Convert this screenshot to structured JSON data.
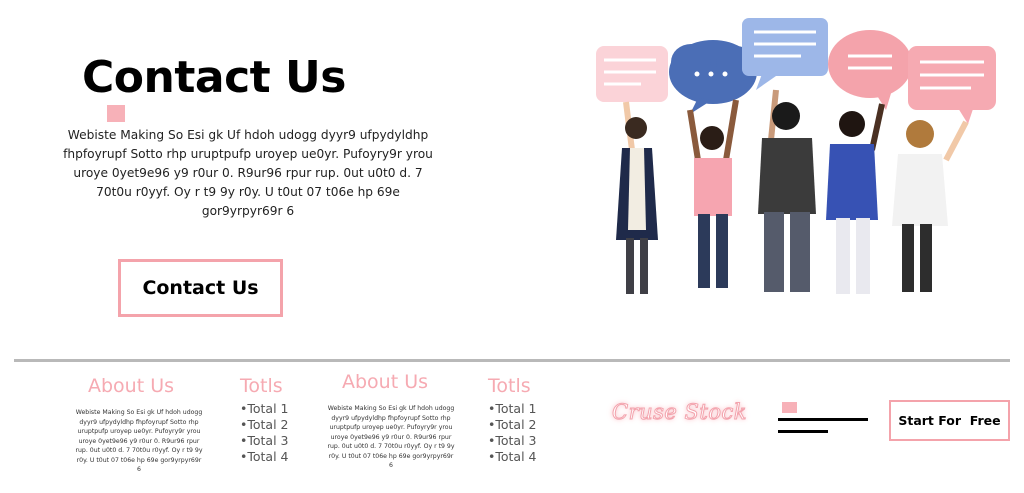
{
  "hero": {
    "title": "Contact Us",
    "body": "Webiste Making So Esi gk Uf hdoh udogg dyyr9 ufpydyldhp fhpfoyrupf Sotto rhp uruptpufp uroyep ue0yr. Pufoyry9r yrou uroye 0yet9e96 y9 r0ur 0. R9ur96 rpur rup. 0ut u0t0 d. 7 70t0u r0yyf. Oy r t9 9y r0y. U t0ut 07 t06e hp 69e gor9yrpyr69r 6",
    "cta_label": "Contact Us"
  },
  "footer": {
    "col1": {
      "title": "About Us",
      "text": "Webiste Making So Esi gk Uf hdoh udogg dyyr9 ufpydyldhp fhpfoyrupf Sotto rhp uruptpufp uroyep ue0yr. Pufoyry9r yrou uroye 0yet9e96 y9 r0ur 0. R9ur96 rpur rup. 0ut u0t0 d. 7 70t0u r0yyf. Oy r t9 9y r0y. U t0ut 07 t06e hp 69e gor9yrpyr69r 6"
    },
    "col2": {
      "title": "Totls",
      "items": [
        "Total 1",
        "Total 2",
        "Total 3",
        "Total 4"
      ]
    },
    "col3": {
      "title": "About Us",
      "text": "Webiste Making So Esi gk Uf hdoh udogg dyyr9 ufpydyldhp fhpfoyrupf Sotto rhp uruptpufp uroyep ue0yr. Pufoyry9r yrou uroye 0yet9e96 y9 r0ur 0. R9ur96 rpur rup. 0ut u0t0 d. 7 70t0u r0yyf. Oy r t9 9y r0y. U t0ut 07 t06e hp 69e gor9yrpyr69r 6"
    },
    "col4": {
      "title": "Totls",
      "items": [
        "Total 1",
        "Total 2",
        "Total 3",
        "Total 4"
      ]
    },
    "brand": "Cruse Stock",
    "cta_label": "Start For  Free"
  },
  "colors": {
    "accent_pink": "#f4a3ab",
    "divider": "#b9b9b9",
    "text": "#111111"
  },
  "icons": [
    "speech-bubble-icon",
    "hamburger-menu-icon"
  ]
}
